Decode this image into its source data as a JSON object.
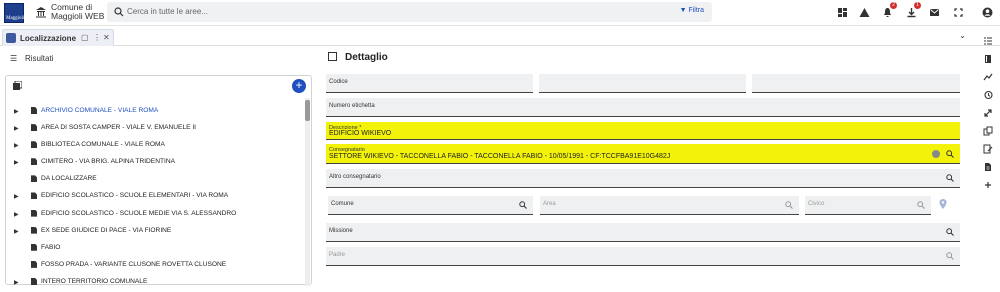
{
  "app": {
    "logo_text": "Maggioli",
    "title_line1": "Comune di",
    "title_line2": "Maggioli WEB"
  },
  "search": {
    "placeholder": "Cerca in tutte le aree...",
    "filter_label": "Filtra"
  },
  "topbar_icons": [
    "apps-icon",
    "warning-icon",
    "notifications-icon",
    "download-icon",
    "mail-icon",
    "fullscreen-icon",
    "account-icon"
  ],
  "badges": {
    "notifications": "2",
    "download": "1"
  },
  "tab": {
    "label": "Localizzazione"
  },
  "left": {
    "title": "Risultati",
    "tree": [
      {
        "label": "ARCHIVIO COMUNALE - VIALE ROMA",
        "expandable": true,
        "active": true
      },
      {
        "label": "AREA DI SOSTA CAMPER - VIALE V. EMANUELE II",
        "expandable": true
      },
      {
        "label": "BIBLIOTECA COMUNALE - VIALE ROMA",
        "expandable": true
      },
      {
        "label": "CIMITERO - VIA BRIG. ALPINA TRIDENTINA",
        "expandable": true
      },
      {
        "label": "DA LOCALIZZARE",
        "expandable": false
      },
      {
        "label": "EDIFICIO SCOLASTICO -  SCUOLE ELEMENTARI -  VIA ROMA",
        "expandable": true
      },
      {
        "label": "EDIFICIO SCOLASTICO - SCUOLE MEDIE VIA S. ALESSANDRO",
        "expandable": true
      },
      {
        "label": "EX SEDE GIUDICE DI PACE - VIA FIORINE",
        "expandable": true
      },
      {
        "label": "FABIO",
        "expandable": false
      },
      {
        "label": "FOSSO PRADA - VARIANTE CLUSONE ROVETTA  CLUSONE",
        "expandable": false
      },
      {
        "label": "INTERO TERRITORIO COMUNALE",
        "expandable": true
      }
    ]
  },
  "detail": {
    "title": "Dettaglio",
    "codice": "Codice",
    "numero_etichetta": "Numero etichetta",
    "descrizione_label": "Descrizione *",
    "descrizione_value": "EDIFICIO WIKIEVO",
    "consegnatario_label": "Consegnatario",
    "consegnatario_value": "SETTORE WIKIEVO - TACCONELLA FABIO - TACCONELLA FABIO - 10/05/1991 - CF:TCCFBA91E10G482J",
    "altro_consegnatario": "Altro consegnatario",
    "comune": "Comune",
    "area": "Area",
    "civico": "Civico",
    "missione": "Missione",
    "padre": "Padre"
  },
  "colors": {
    "accent": "#1f4fbf",
    "highlight": "#f2f20a",
    "logo": "#1d3f8c"
  }
}
